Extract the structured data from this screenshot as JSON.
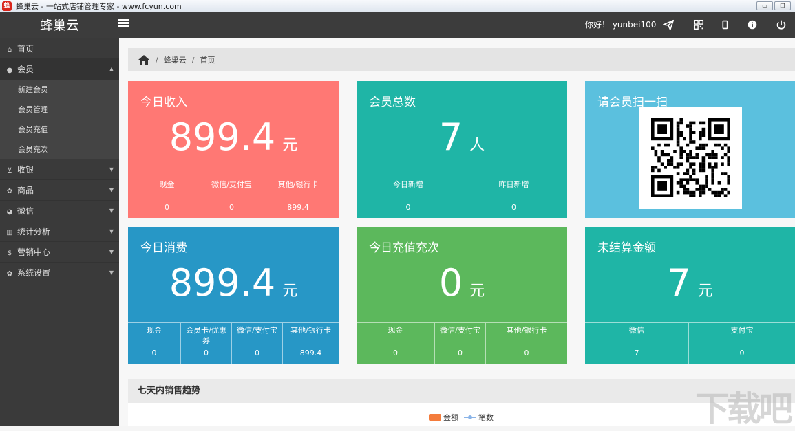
{
  "window": {
    "title": "蜂巢云 - 一站式店铺管理专家 - www.fcyun.com",
    "icon": "app-logo-icon"
  },
  "header": {
    "brand": "蜂巢云",
    "greeting": "你好！ yunbei100"
  },
  "sidebar": {
    "items": [
      {
        "label": "首页",
        "icon": "home-icon"
      },
      {
        "label": "会员",
        "icon": "user-icon",
        "open": true,
        "children": [
          "新建会员",
          "会员管理",
          "会员充值",
          "会员充次"
        ]
      },
      {
        "label": "收银",
        "icon": "cart-icon"
      },
      {
        "label": "商品",
        "icon": "cogs-icon"
      },
      {
        "label": "微信",
        "icon": "wechat-icon"
      },
      {
        "label": "统计分析",
        "icon": "bar-chart-icon"
      },
      {
        "label": "营销中心",
        "icon": "dollar-icon"
      },
      {
        "label": "系统设置",
        "icon": "cogs-icon"
      }
    ]
  },
  "breadcrumb": [
    "蜂巢云",
    "首页"
  ],
  "cards": {
    "income": {
      "title": "今日收入",
      "value": "899.4",
      "unit": "元",
      "cells": [
        {
          "label": "现金",
          "value": "0"
        },
        {
          "label": "微信/支付宝",
          "value": "0"
        },
        {
          "label": "其他/银行卡",
          "value": "899.4"
        }
      ]
    },
    "members": {
      "title": "会员总数",
      "value": "7",
      "unit": "人",
      "cells": [
        {
          "label": "今日新增",
          "value": "0"
        },
        {
          "label": "昨日新增",
          "value": "0"
        }
      ]
    },
    "scan": {
      "title": "请会员扫一扫"
    },
    "spend": {
      "title": "今日消费",
      "value": "899.4",
      "unit": "元",
      "cells": [
        {
          "label": "现金",
          "value": "0"
        },
        {
          "label": "会员卡/优惠券",
          "value": "0"
        },
        {
          "label": "微信/支付宝",
          "value": "0"
        },
        {
          "label": "其他/银行卡",
          "value": "899.4"
        }
      ]
    },
    "recharge": {
      "title": "今日充值充次",
      "value": "0",
      "unit": "元",
      "cells": [
        {
          "label": "现金",
          "value": "0"
        },
        {
          "label": "微信/支付宝",
          "value": "0"
        },
        {
          "label": "其他/银行卡",
          "value": "0"
        }
      ]
    },
    "unsettled": {
      "title": "未结算金额",
      "value": "7",
      "unit": "元",
      "cells": [
        {
          "label": "微信",
          "value": "7"
        },
        {
          "label": "支付宝",
          "value": "0"
        }
      ]
    }
  },
  "trend": {
    "title": "七天内销售趋势",
    "legend": [
      "金额",
      "笔数"
    ]
  },
  "colors": {
    "red": "#ff7874",
    "teal": "#1fb5a6",
    "sky": "#5bc0de",
    "blue": "#2797c6",
    "green": "#5cb85c",
    "sidebar": "#3a3a3a"
  }
}
